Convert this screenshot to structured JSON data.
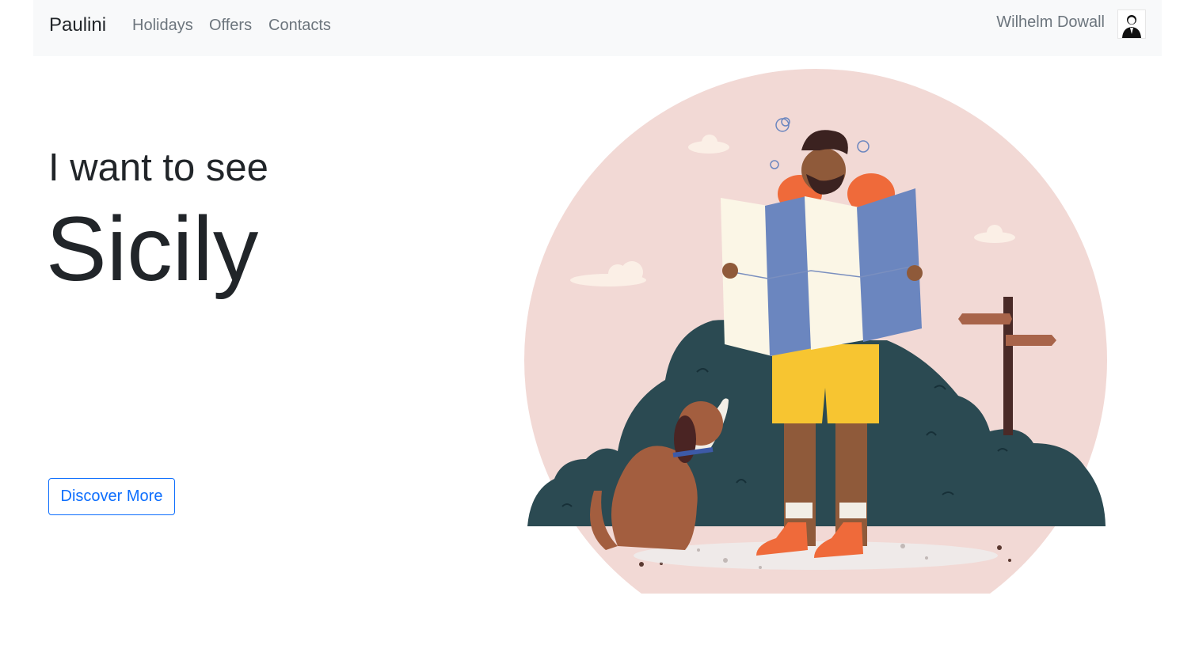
{
  "navbar": {
    "brand": "Paulini",
    "links": [
      "Holidays",
      "Offers",
      "Contacts"
    ],
    "user_name": "Wilhelm Dowall",
    "avatar_icon": "user-avatar-icon"
  },
  "hero": {
    "subtitle": "I want to see",
    "destination": "Sicily",
    "cta_label": "Discover More"
  },
  "colors": {
    "accent": "#0d6efd",
    "navbar_bg": "#f8f9fa",
    "circle": "#f2d9d5",
    "bushes": "#2b4a52",
    "map_blue": "#6b86bf",
    "map_cream": "#fbf6e6",
    "shorts": "#f7c531",
    "backpack": "#ef6a3a"
  }
}
